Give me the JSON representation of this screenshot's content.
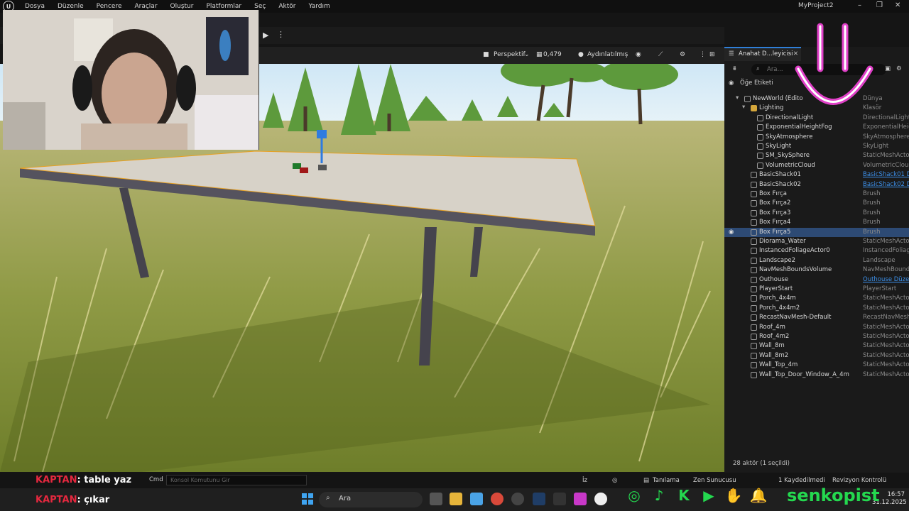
{
  "window": {
    "project_title": "MyProject2",
    "menu": [
      "Dosya",
      "Düzenle",
      "Pencere",
      "Araçlar",
      "Oluştur",
      "Platformlar",
      "Seç",
      "Aktör",
      "Yardım"
    ],
    "controls": [
      "–",
      "❐",
      "✕"
    ]
  },
  "viewport_bar": {
    "perspective": "Perspektif",
    "zoom": "0,479",
    "lighting": "Aydınlatılmış"
  },
  "outliner": {
    "tab_title": "Anahat D...leyicisi",
    "search_placeholder": "Ara...",
    "column_label": "Öğe Etiketi",
    "items": [
      {
        "name": "NewWorld (Edito",
        "type": "Dünya",
        "indent": 2,
        "expand": "▾"
      },
      {
        "name": "Lighting",
        "type": "Klasör",
        "indent": 3,
        "expand": "▾",
        "folder": true
      },
      {
        "name": "DirectionalLight",
        "type": "DirectionalLight",
        "indent": 4
      },
      {
        "name": "ExponentialHeightFog",
        "type": "ExponentialHeigh",
        "indent": 4
      },
      {
        "name": "SkyAtmosphere",
        "type": "SkyAtmosphere",
        "indent": 4
      },
      {
        "name": "SkyLight",
        "type": "SkyLight",
        "indent": 4
      },
      {
        "name": "SM_SkySphere",
        "type": "StaticMeshActor",
        "indent": 4
      },
      {
        "name": "VolumetricCloud",
        "type": "VolumetricCloud",
        "indent": 4
      },
      {
        "name": "BasicShack01",
        "type": "BasicShack01 D",
        "indent": 3,
        "link": true
      },
      {
        "name": "BasicShack02",
        "type": "BasicShack02 D",
        "indent": 3,
        "link": true
      },
      {
        "name": "Box Fırça",
        "type": "Brush",
        "indent": 3
      },
      {
        "name": "Box Fırça2",
        "type": "Brush",
        "indent": 3
      },
      {
        "name": "Box Fırça3",
        "type": "Brush",
        "indent": 3
      },
      {
        "name": "Box Fırça4",
        "type": "Brush",
        "indent": 3
      },
      {
        "name": "Box Fırça5",
        "type": "Brush",
        "indent": 3,
        "selected": true
      },
      {
        "name": "Diorama_Water",
        "type": "StaticMeshActor",
        "indent": 3
      },
      {
        "name": "InstancedFoliageActor0",
        "type": "InstancedFoliage",
        "indent": 3
      },
      {
        "name": "Landscape2",
        "type": "Landscape",
        "indent": 3
      },
      {
        "name": "NavMeshBoundsVolume",
        "type": "NavMeshBounds",
        "indent": 3
      },
      {
        "name": "Outhouse",
        "type": "Outhouse Düzer",
        "indent": 3,
        "link": true
      },
      {
        "name": "PlayerStart",
        "type": "PlayerStart",
        "indent": 3
      },
      {
        "name": "Porch_4x4m",
        "type": "StaticMeshActor",
        "indent": 3
      },
      {
        "name": "Porch_4x4m2",
        "type": "StaticMeshActor",
        "indent": 3
      },
      {
        "name": "RecastNavMesh-Default",
        "type": "RecastNavMesh",
        "indent": 3
      },
      {
        "name": "Roof_4m",
        "type": "StaticMeshActor",
        "indent": 3
      },
      {
        "name": "Roof_4m2",
        "type": "StaticMeshActor",
        "indent": 3
      },
      {
        "name": "Wall_8m",
        "type": "StaticMeshActor",
        "indent": 3
      },
      {
        "name": "Wall_8m2",
        "type": "StaticMeshActor",
        "indent": 3
      },
      {
        "name": "Wall_Top_4m",
        "type": "StaticMeshActor",
        "indent": 3
      },
      {
        "name": "Wall_Top_Door_Window_A_4m",
        "type": "StaticMeshActor",
        "indent": 3
      }
    ],
    "footer": "28 aktör (1 seçildi)"
  },
  "statusbar": {
    "cmd_label": "Cmd",
    "cmd_placeholder": "Konsol Komutunu Gir",
    "iz": "İz",
    "tanilama": "Tanılama",
    "zen": "Zen Sunucusu",
    "saved": "1 Kaydedilmedi",
    "revision": "Revizyon Kontrolü"
  },
  "taskbar": {
    "search_label": "Ara",
    "time": "16:57",
    "date": "31.12.2025"
  },
  "stream": {
    "chat1_user": "KAPTAN",
    "chat1_text": ": table yaz",
    "chat2_user": "KAPTAN",
    "chat2_text": ": çıkar",
    "brand": "senkopist"
  },
  "colors": {
    "accent": "#2f7fd8",
    "selection": "#2d4a74",
    "brand_green": "#24d84f",
    "overlay_pink": "#e040c8"
  }
}
